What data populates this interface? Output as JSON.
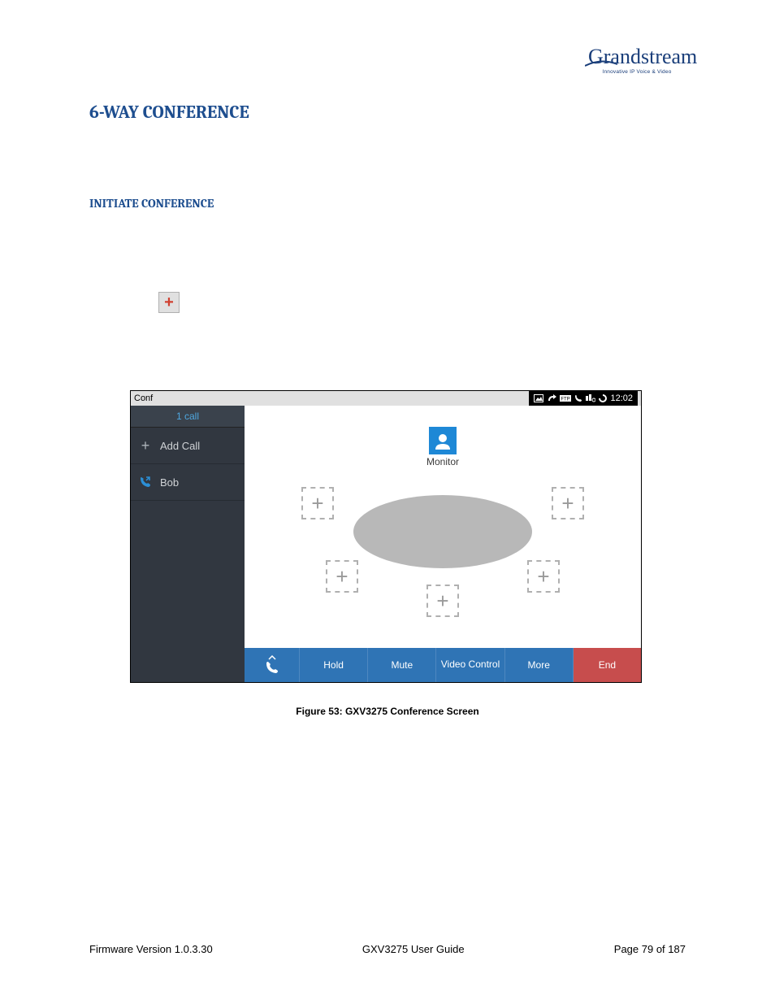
{
  "logo": {
    "brand": "Grandstream",
    "tagline": "Innovative IP Voice & Video"
  },
  "section_title": "6-WAY CONFERENCE",
  "subsection_title": "INITIATE CONFERENCE",
  "screenshot": {
    "status_bar": {
      "app_label": "Conf",
      "time": "12:02"
    },
    "sidebar": {
      "tab_label": "1 call",
      "add_call_label": "Add Call",
      "contact_name": "Bob"
    },
    "main": {
      "monitor_label": "Monitor"
    },
    "toolbar": {
      "hold": "Hold",
      "mute": "Mute",
      "video_control": "Video Control",
      "more": "More",
      "end": "End"
    }
  },
  "figure_caption": "Figure 53: GXV3275 Conference Screen",
  "footer": {
    "firmware": "Firmware Version 1.0.3.30",
    "doc_title": "GXV3275 User Guide",
    "page": "Page 79 of 187"
  }
}
